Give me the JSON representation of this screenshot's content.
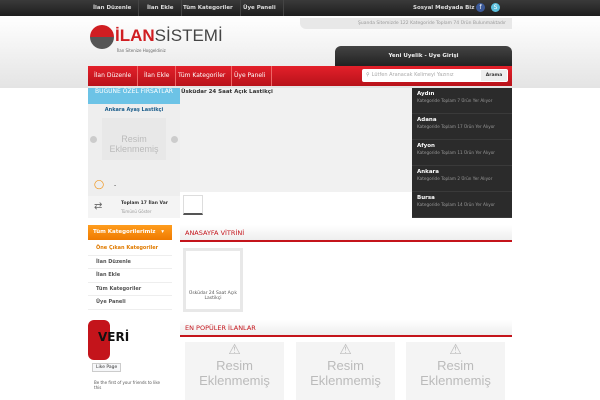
{
  "topbar": {
    "links": [
      "İlan Düzenle",
      "İlan Ekle",
      "Tüm Kategoriler",
      "Üye Paneli"
    ],
    "social": "Sosyal Medyada Biz"
  },
  "header": {
    "logo_red": "İLAN",
    "logo_dark": "SİSTEMİ",
    "tagline": "İlan Sitenize Hoşgeldiniz",
    "notice": "Şuanda Sitemizde 122 Kategoride Toplam 74 Ürün Bulunmaktadır",
    "member_tab": "Yeni Uyelik - Uye Girişi"
  },
  "nav": {
    "links": [
      "İlan Düzenle",
      "İlan Ekle",
      "Tüm Kategoriler",
      "Üye Paneli"
    ],
    "search_placeholder": "Lütfen Aranacak Kelimeyi Yazınız",
    "search_button": "Arama"
  },
  "deals": {
    "title": "BUGÜNE ÖZEL FIRSATLAR",
    "item": "Ankara Ayaş Lastikçi",
    "no_image": "Resim Eklenmemiş",
    "price": "-",
    "total": "Toplam 17 İlan Var",
    "show_all": "Tümünü Göster"
  },
  "slider": {
    "title": "Üsküdar 24 Saat Açık Lastikçi"
  },
  "cities": [
    {
      "name": "Aydın",
      "desc": "Kategoride Toplam 7 Ürün Yer Alıyor"
    },
    {
      "name": "Adana",
      "desc": "Kategoride Toplam 17 Ürün Yer Alıyor"
    },
    {
      "name": "Afyon",
      "desc": "Kategoride Toplam 11 Ürün Yer Alıyor"
    },
    {
      "name": "Ankara",
      "desc": "Kategoride Toplam 2 Ürün Yer Alıyor"
    },
    {
      "name": "Bursa",
      "desc": "Kategoride Toplam 14 Ürün Yer Alıyor"
    }
  ],
  "sidebar": {
    "title": "Tüm Kategorilerimiz",
    "items": [
      "Öne Çıkan Kategoriler",
      "İlan Düzenle",
      "İlan Ekle",
      "Tüm Kategoriler",
      "Üye Paneli"
    ],
    "fb_like": "Like Page",
    "fb_text": "Be the first of your friends to like this",
    "fb_logo": "HABER VERİ"
  },
  "showcase": {
    "title": "ANASAYFA VİTRİNİ",
    "item": "Üsküdar 24 Saat Açık Lastikçi"
  },
  "popular": {
    "title": "EN POPÜLER İLANLAR",
    "no_image": "Resim Eklenmemiş"
  }
}
